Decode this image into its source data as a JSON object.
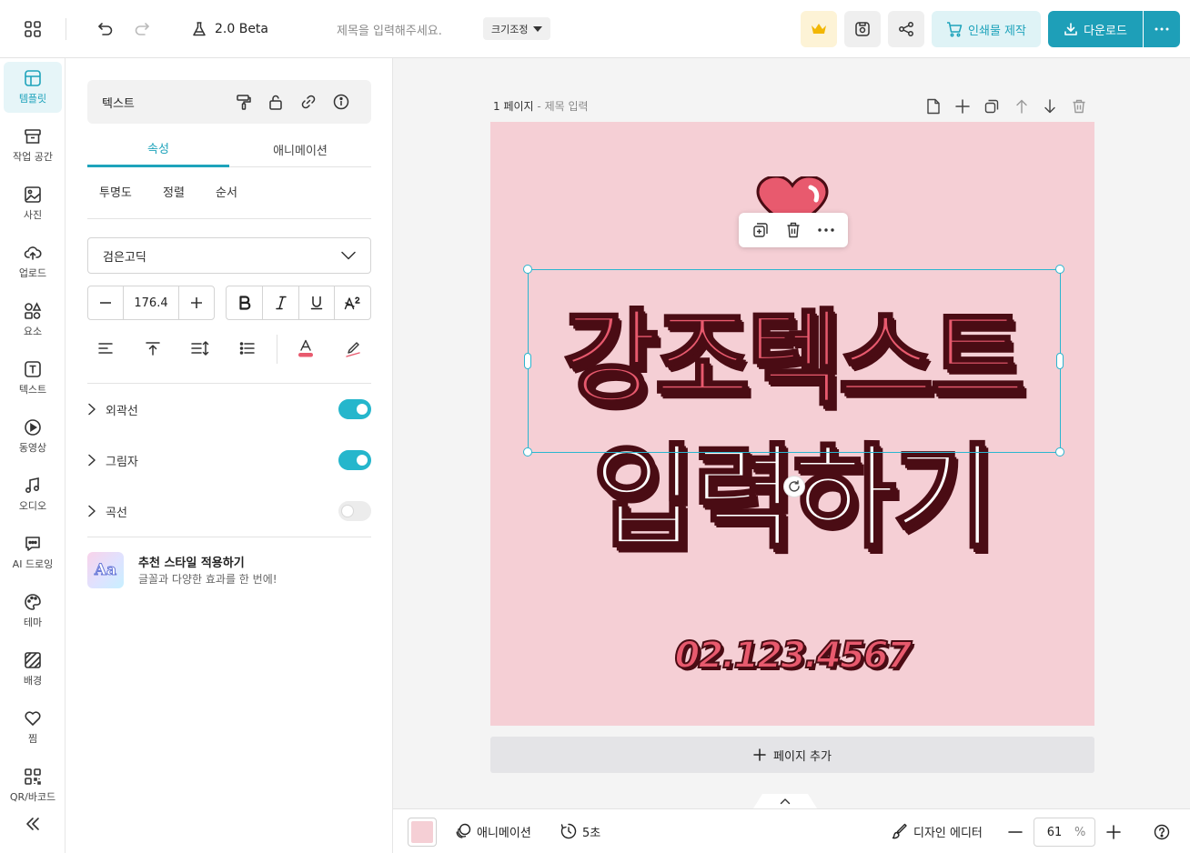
{
  "topbar": {
    "beta_label": "2.0 Beta",
    "title_placeholder": "제목을 입력해주세요.",
    "resize_label": "크기조정",
    "print_label": "인쇄물 제작",
    "download_label": "다운로드"
  },
  "rail": {
    "items": [
      {
        "label": "템플릿",
        "icon": "template-icon"
      },
      {
        "label": "작업 공간",
        "icon": "archive-icon"
      },
      {
        "label": "사진",
        "icon": "image-icon"
      },
      {
        "label": "업로드",
        "icon": "upload-cloud-icon"
      },
      {
        "label": "요소",
        "icon": "shapes-icon"
      },
      {
        "label": "텍스트",
        "icon": "text-icon"
      },
      {
        "label": "동영상",
        "icon": "play-icon"
      },
      {
        "label": "오디오",
        "icon": "music-icon"
      },
      {
        "label": "AI 드로잉",
        "icon": "ai-chat-icon"
      },
      {
        "label": "테마",
        "icon": "palette-icon"
      },
      {
        "label": "배경",
        "icon": "pattern-icon"
      },
      {
        "label": "찜",
        "icon": "heart-icon"
      },
      {
        "label": "QR/바코드",
        "icon": "qr-icon"
      }
    ]
  },
  "panel": {
    "header_title": "텍스트",
    "tabs": [
      "속성",
      "애니메이션"
    ],
    "subtabs": [
      "투명도",
      "정렬",
      "순서"
    ],
    "font_family": "검은고딕",
    "font_size": "176.4",
    "toggles": [
      {
        "label": "외곽선",
        "on": true
      },
      {
        "label": "그림자",
        "on": true
      },
      {
        "label": "곡선",
        "on": false
      }
    ],
    "recommend_title": "추천 스타일 적용하기",
    "recommend_sub": "글꼴과 다양한 효과를 한 번에!",
    "recommend_thumb": "Aa"
  },
  "workspace": {
    "page_label": "1 페이지",
    "page_title": "제목 입력",
    "canvas": {
      "line1": "강조텍스트",
      "line2": "입력하기",
      "phone": "02.123.4567",
      "background": "#f5cfd5",
      "accent": "#e85a6e",
      "stroke": "#4a0c14"
    },
    "add_page_label": "페이지 추가"
  },
  "bottombar": {
    "animation_label": "애니메이션",
    "duration_label": "5초",
    "editor_label": "디자인 에디터",
    "zoom": "61",
    "zoom_unit": "%"
  }
}
